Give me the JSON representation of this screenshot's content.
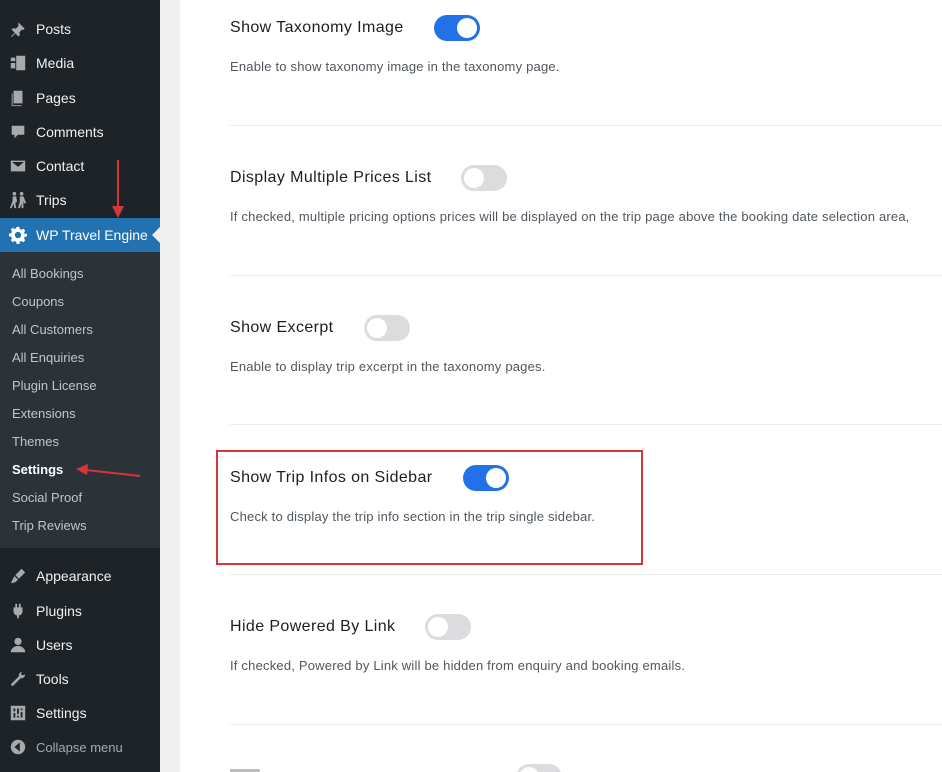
{
  "sidebar": {
    "top_items": [
      {
        "label": "Posts",
        "icon": "pushpin-icon"
      },
      {
        "label": "Media",
        "icon": "media-icon"
      },
      {
        "label": "Pages",
        "icon": "pages-icon"
      },
      {
        "label": "Comments",
        "icon": "comment-icon"
      },
      {
        "label": "Contact",
        "icon": "mail-icon"
      },
      {
        "label": "Trips",
        "icon": "hikers-icon"
      }
    ],
    "active_item": {
      "label": "WP Travel Engine",
      "icon": "gear-icon"
    },
    "submenu": [
      "All Bookings",
      "Coupons",
      "All Customers",
      "All Enquiries",
      "Plugin License",
      "Extensions",
      "Themes",
      "Settings",
      "Social Proof",
      "Trip Reviews"
    ],
    "submenu_current": "Settings",
    "bottom_items": [
      {
        "label": "Appearance",
        "icon": "brush-icon"
      },
      {
        "label": "Plugins",
        "icon": "plug-icon"
      },
      {
        "label": "Users",
        "icon": "user-icon"
      },
      {
        "label": "Tools",
        "icon": "wrench-icon"
      },
      {
        "label": "Settings",
        "icon": "sliders-icon"
      }
    ],
    "collapse_label": "Collapse menu"
  },
  "settings": [
    {
      "title": "Show Taxonomy Image",
      "enabled": true,
      "description": "Enable to show taxonomy image in the taxonomy page."
    },
    {
      "title": "Display Multiple Prices List",
      "enabled": false,
      "description": "If checked, multiple pricing options prices will be displayed on the trip page above the booking date selection area,"
    },
    {
      "title": "Show Excerpt",
      "enabled": false,
      "description": "Enable to display trip excerpt in the taxonomy pages."
    },
    {
      "title": "Show Trip Infos on Sidebar",
      "enabled": true,
      "description": "Check to display the trip info section in the trip single sidebar."
    },
    {
      "title": "Hide Powered By Link",
      "enabled": false,
      "description": "If checked, Powered by Link will be hidden from enquiry and booking emails."
    }
  ],
  "colors": {
    "sidebar_bg": "#1d2327",
    "submenu_bg": "#2c3338",
    "active_bg": "#2271b1",
    "toggle_on": "#2271e8",
    "toggle_off": "#dcdcde",
    "annotation_red": "#d63638"
  }
}
